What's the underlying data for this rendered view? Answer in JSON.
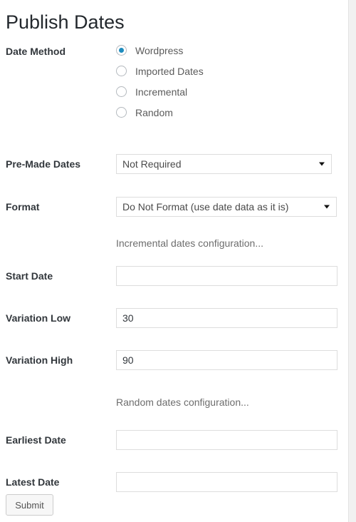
{
  "page": {
    "title": "Publish Dates"
  },
  "form": {
    "date_method": {
      "label": "Date Method",
      "options": [
        {
          "label": "Wordpress",
          "selected": true
        },
        {
          "label": "Imported Dates",
          "selected": false
        },
        {
          "label": "Incremental",
          "selected": false
        },
        {
          "label": "Random",
          "selected": false
        }
      ]
    },
    "pre_made_dates": {
      "label": "Pre-Made Dates",
      "value": "Not Required",
      "arrow_icon": "chevron-down-icon"
    },
    "format": {
      "label": "Format",
      "value": "Do Not Format (use date data as it is)",
      "arrow_icon": "chevron-down-icon"
    },
    "incremental_note": "Incremental dates configuration...",
    "start_date": {
      "label": "Start Date",
      "value": ""
    },
    "variation_low": {
      "label": "Variation Low",
      "value": "30"
    },
    "variation_high": {
      "label": "Variation High",
      "value": "90"
    },
    "random_note": "Random dates configuration...",
    "earliest_date": {
      "label": "Earliest Date",
      "value": ""
    },
    "latest_date": {
      "label": "Latest Date",
      "value": ""
    },
    "submit": {
      "label": "Submit"
    }
  },
  "colors": {
    "accent": "#1e8cbe",
    "label_text": "#32373c",
    "muted_text": "#6d6d6d",
    "border": "#dddddd",
    "page_background": "#ffffff",
    "outer_background": "#f1f1f1"
  }
}
